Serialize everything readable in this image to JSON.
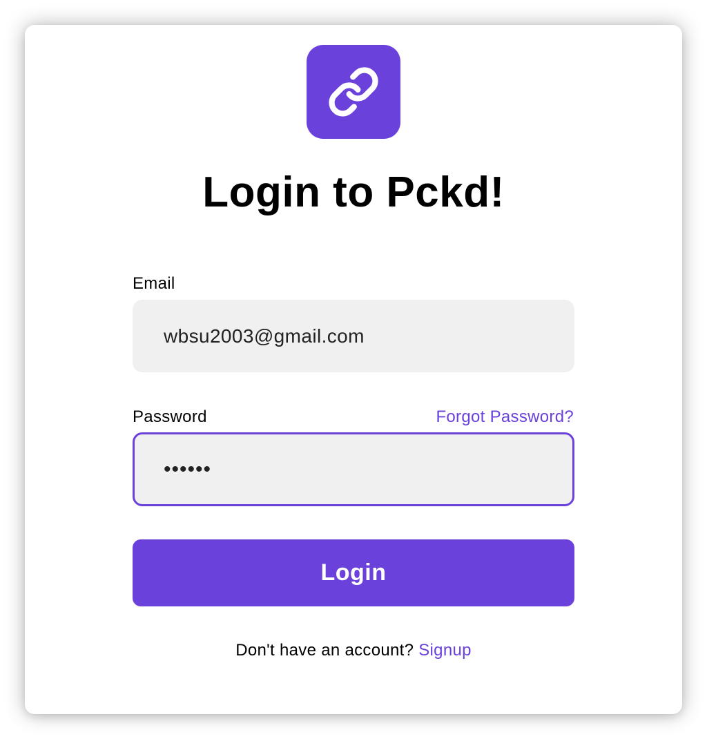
{
  "brand": {
    "accent_color": "#6b41dc",
    "logo_icon": "link-icon"
  },
  "header": {
    "title": "Login to Pckd!"
  },
  "form": {
    "email_label": "Email",
    "email_value": "wbsu2003@gmail.com",
    "password_label": "Password",
    "password_value": "••••••",
    "forgot_password": "Forgot Password?",
    "submit_label": "Login"
  },
  "footer": {
    "prompt": "Don't have an account?",
    "signup_link": "Signup"
  }
}
